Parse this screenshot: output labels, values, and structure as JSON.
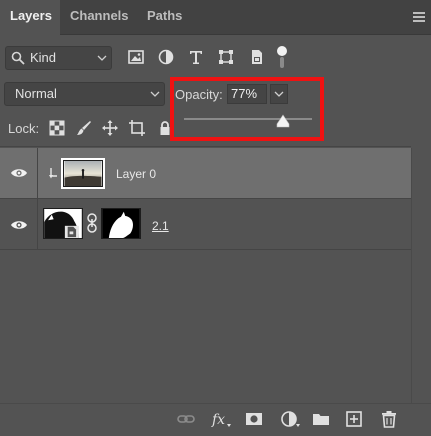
{
  "tabs": [
    {
      "label": "Layers",
      "active": true
    },
    {
      "label": "Channels",
      "active": false
    },
    {
      "label": "Paths",
      "active": false
    }
  ],
  "filter": {
    "kind_label": "Kind"
  },
  "blend_mode": {
    "value": "Normal"
  },
  "opacity": {
    "label": "Opacity:",
    "value": "77%",
    "slider_percent": 77
  },
  "lock": {
    "label": "Lock:"
  },
  "layers": [
    {
      "name": "Layer 0",
      "visible": true,
      "selected": true,
      "clipped": true
    },
    {
      "name": "2.1",
      "visible": true,
      "selected": false,
      "smart_object": true,
      "has_mask": true
    }
  ],
  "colors": {
    "highlight": "#ef1212",
    "panel": "#535353",
    "selected_row": "#6f6f6f"
  }
}
